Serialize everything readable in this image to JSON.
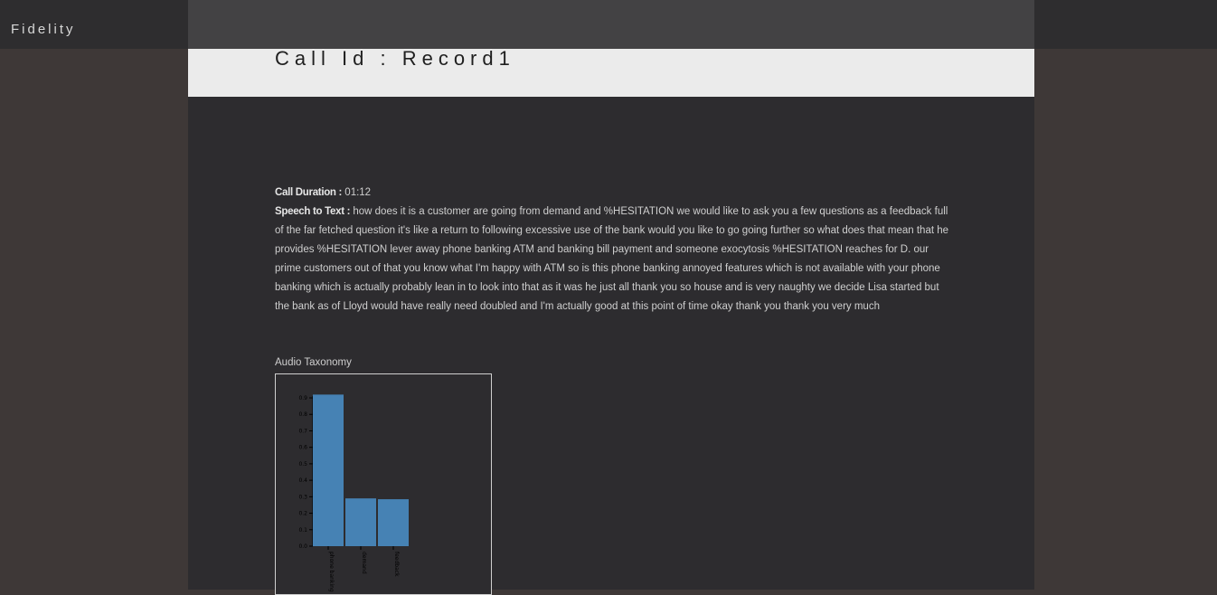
{
  "topbar": {
    "brand": "Fidelity"
  },
  "page": {
    "title": "Call Id : Record1"
  },
  "call": {
    "duration_label": "Call Duration :",
    "duration_value": "01:12",
    "speech_label": "Speech to Text :",
    "speech_text": "how does it is a customer are going from demand and %HESITATION we would like to ask you a few questions as a feedback full of the far fetched question it's like a return to following excessive use of the bank would you like to go going further so what does that mean that he provides %HESITATION lever away phone banking ATM and banking bill payment and someone exocytosis %HESITATION reaches for D. our prime customers out of that you know what I'm happy with ATM so is this phone banking annoyed features which is not available with your phone banking which is actually probably lean in to look into that as it was he just all thank you so house and is very naughty we decide Lisa started but the bank as of Lloyd would have really need doubled and I'm actually good at this point of time okay thank you thank you very much"
  },
  "taxonomy": {
    "label": "Audio Taxonomy"
  },
  "colors": {
    "bar": "#4682b4",
    "panel": "#2d2c2f",
    "title_bar": "#ebebeb"
  },
  "chart_data": {
    "type": "bar",
    "categories": [
      "phone banking",
      "demand",
      "feedback"
    ],
    "values": [
      0.92,
      0.29,
      0.285
    ],
    "title": "",
    "xlabel": "",
    "ylabel": "",
    "ylim": [
      0,
      0.9
    ],
    "yticks": [
      "0.0",
      "0.1",
      "0.2",
      "0.3",
      "0.4",
      "0.5",
      "0.6",
      "0.7",
      "0.8",
      "0.9"
    ]
  }
}
